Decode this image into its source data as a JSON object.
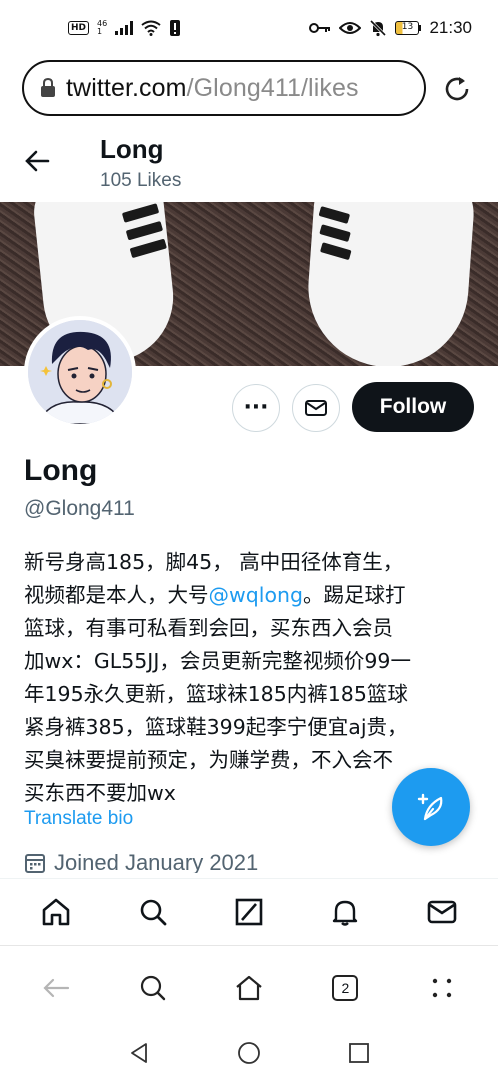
{
  "status_bar": {
    "hd": "HD",
    "network_top": "46",
    "network_bottom": "1",
    "battery": "13",
    "time": "21:30",
    "icons": [
      "key-icon",
      "eye-icon",
      "mute-bell-icon",
      "wifi-icon",
      "signal-icon",
      "alert-icon"
    ]
  },
  "browser": {
    "url_domain": "twitter.com",
    "url_path": "/Glong411/likes",
    "tab_count": "2"
  },
  "header": {
    "name": "Long",
    "subtitle": "105 Likes"
  },
  "profile": {
    "name": "Long",
    "handle": "@Glong411",
    "follow_label": "Follow",
    "more_label": "···",
    "bio_before": "新号身高185，脚45， 高中田径体育生，\n视频都是本人，大号",
    "bio_mention": "@wqlong",
    "bio_after": "。踢足球打\n篮球，有事可私看到会回，买东西入会员\n加wx：GL55JJ，会员更新完整视频价99一\n年195永久更新，篮球袜185内裤185篮球\n紧身裤385，篮球鞋399起李宁便宜aj贵，\n买臭袜要提前预定，为赚学费，不入会不\n买东西不要加wx",
    "translate_label": "Translate bio",
    "joined": "Joined January 2021"
  },
  "twitter_nav": [
    "home-icon",
    "search-icon",
    "communities-icon",
    "notifications-icon",
    "messages-icon"
  ],
  "browser_nav": [
    "back-icon",
    "search-icon",
    "home-icon",
    "tabs-icon",
    "menu-icon"
  ],
  "colors": {
    "accent": "#1d9bf0",
    "text": "#0f1419",
    "secondary": "#536471",
    "follow_bg": "#0f1419"
  }
}
